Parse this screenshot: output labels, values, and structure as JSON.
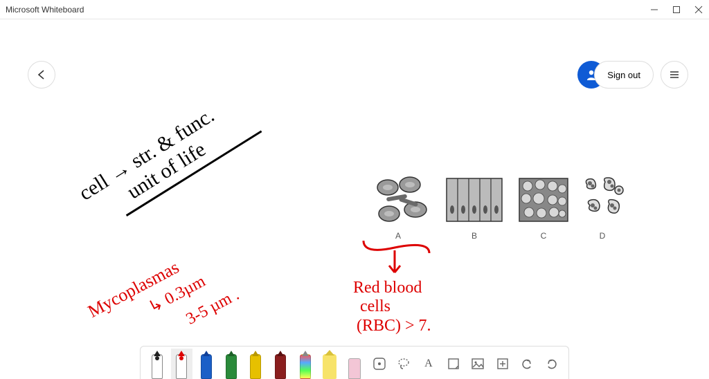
{
  "window": {
    "title": "Microsoft Whiteboard"
  },
  "header": {
    "signout_label": "Sign out"
  },
  "handwriting": {
    "black_line1": "cell → str. & func.",
    "black_line2": "unit of life",
    "red_line1": "Mycoplasmas",
    "red_line2": "↳ 0.3µm",
    "red_line3": "3-5 µm .",
    "red_line4": "Red blood",
    "red_line5": "cells",
    "red_line6": "(RBC)  > 7."
  },
  "diagram": {
    "labels": [
      "A",
      "B",
      "C",
      "D"
    ]
  },
  "toolbar": {
    "pens": [
      {
        "name": "pen-black",
        "color": "#222"
      },
      {
        "name": "pen-red",
        "color": "#d00"
      },
      {
        "name": "pen-blue",
        "color": "#1b5fc7"
      },
      {
        "name": "pen-green",
        "color": "#2a8a3a"
      },
      {
        "name": "pen-yellow",
        "color": "#e6c000"
      },
      {
        "name": "pen-darkred",
        "color": "#8a1e1e"
      },
      {
        "name": "pen-rainbow",
        "color": "linear"
      },
      {
        "name": "highlighter-yellow",
        "color": "#f7e36a"
      },
      {
        "name": "eraser",
        "color": "#f3c6d6"
      }
    ],
    "tools": [
      {
        "name": "ruler-tool"
      },
      {
        "name": "lasso-tool"
      },
      {
        "name": "text-tool",
        "glyph": "A"
      },
      {
        "name": "shape-note-tool"
      },
      {
        "name": "image-tool"
      },
      {
        "name": "add-tool"
      },
      {
        "name": "undo-tool"
      },
      {
        "name": "redo-tool"
      }
    ]
  }
}
